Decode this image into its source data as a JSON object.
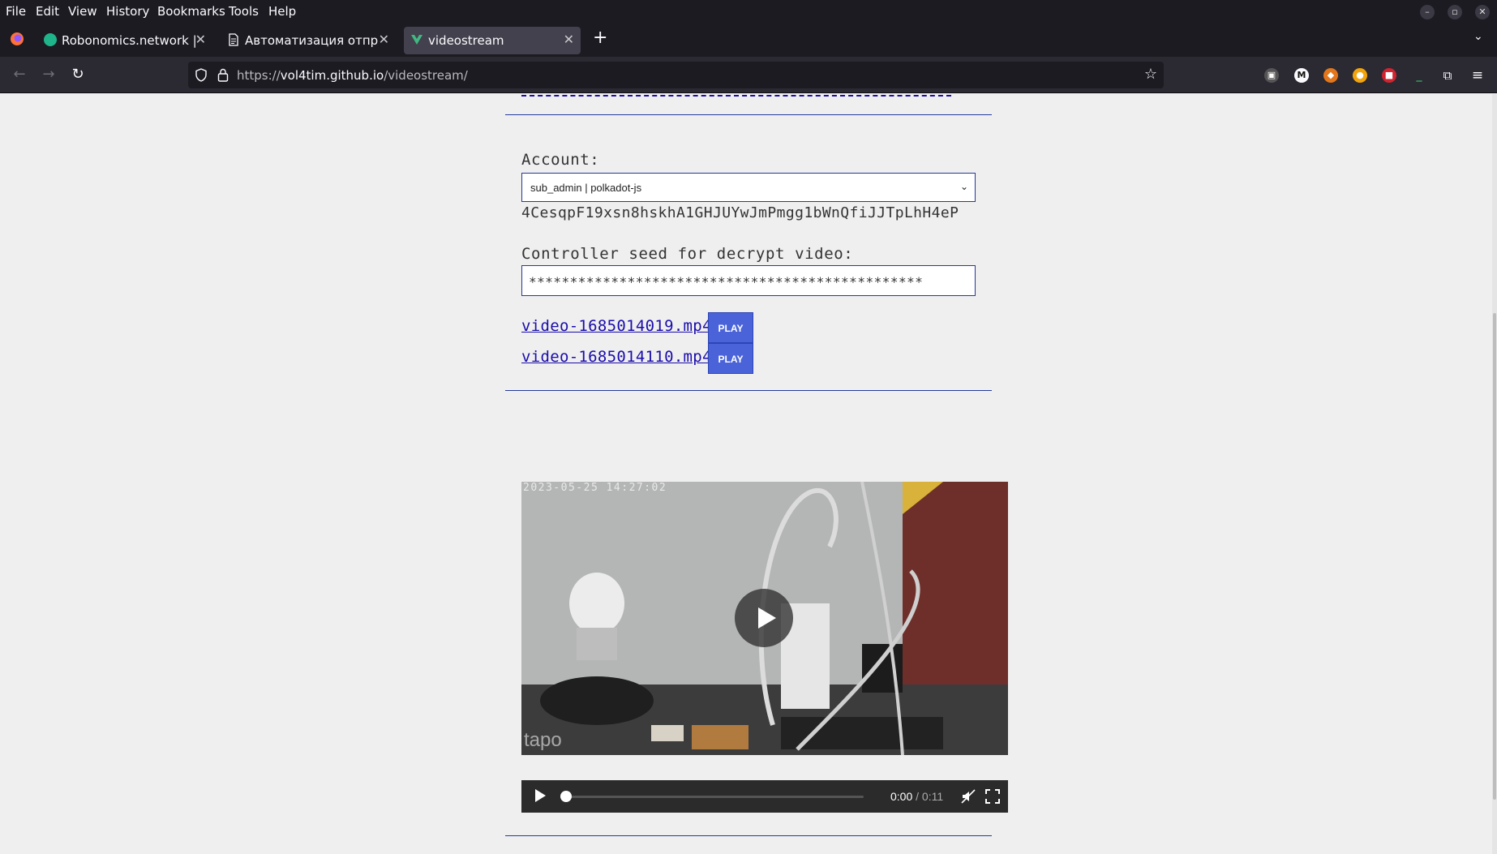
{
  "menubar": {
    "items": [
      "File",
      "Edit",
      "View",
      "History",
      "Bookmarks",
      "Tools",
      "Help"
    ]
  },
  "tabs": [
    {
      "title": "Robonomics.network | vc",
      "active": false
    },
    {
      "title": "Автоматизация отправк",
      "active": false
    },
    {
      "title": "videostream",
      "active": true
    }
  ],
  "url": {
    "prefix": "https://",
    "host": "vol4tim.github.io",
    "path": "/videostream/"
  },
  "form": {
    "account_label": "Account:",
    "account_selected": "sub_admin | polkadot-js",
    "address": "4CesqpF19xsn8hskhA1GHJUYwJmPmgg1bWnQfiJJTpLhH4eP",
    "seed_label": "Controller seed for decrypt video:",
    "seed_value": "************************************************"
  },
  "videos": [
    {
      "name": "video-1685014019.mp4",
      "button": "PLAY"
    },
    {
      "name": "video-1685014110.mp4",
      "button": "PLAY"
    }
  ],
  "player": {
    "timestamp": "2023-05-25 14:27:02",
    "watermark": "tapo",
    "current_time": "0:00",
    "duration": "/ 0:11",
    "progress": 0
  },
  "colors": {
    "accent": "#4a63d8",
    "divider": "#233a9c",
    "link": "#1a0dab"
  }
}
